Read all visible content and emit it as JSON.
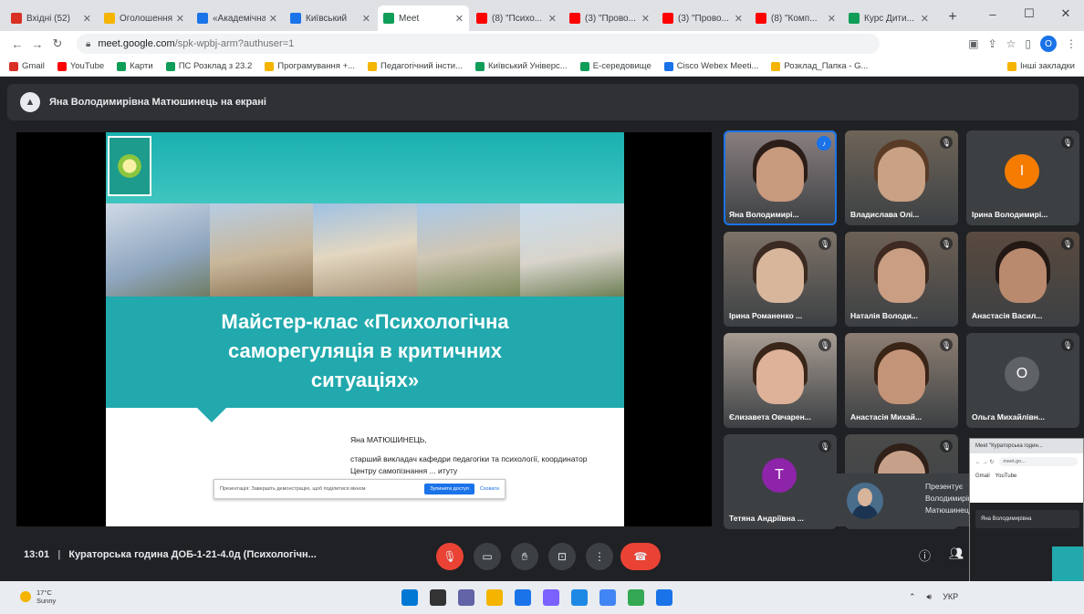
{
  "browser": {
    "tabs": [
      {
        "label": "Вхідні (52)",
        "color": "#d93025"
      },
      {
        "label": "Оголошення",
        "color": "#f4b400"
      },
      {
        "label": "«Академічна",
        "color": "#1a73e8"
      },
      {
        "label": "Київський",
        "color": "#1a73e8"
      },
      {
        "label": "Meet",
        "color": "#0f9d58",
        "active": true
      },
      {
        "label": "(8) \"Психо...",
        "color": "#ff0000"
      },
      {
        "label": "(3) \"Прово...",
        "color": "#ff0000"
      },
      {
        "label": "(3) \"Прово...",
        "color": "#ff0000"
      },
      {
        "label": "(8) \"Комп...",
        "color": "#ff0000"
      },
      {
        "label": "Курс Дити...",
        "color": "#0f9d58"
      }
    ],
    "url_host": "meet.google.com",
    "url_path": "/spk-wpbj-arm?authuser=1",
    "bookmarks": [
      {
        "label": "Gmail",
        "color": "#d93025"
      },
      {
        "label": "YouTube",
        "color": "#ff0000"
      },
      {
        "label": "Карти",
        "color": "#0f9d58"
      },
      {
        "label": "ПС Розклад з 23.2",
        "color": "#0f9d58"
      },
      {
        "label": "Програмування +...",
        "color": "#f4b400"
      },
      {
        "label": "Педагогічний інсти...",
        "color": "#f4b400"
      },
      {
        "label": "Київський Універс...",
        "color": "#0f9d58"
      },
      {
        "label": "Е-середовище",
        "color": "#0f9d58"
      },
      {
        "label": "Cisco Webex Meeti...",
        "color": "#1a73e8"
      },
      {
        "label": "Розклад_Папка - G...",
        "color": "#f4b400"
      }
    ],
    "other_bookmarks": "Інші закладки",
    "profile_letter": "O"
  },
  "meet": {
    "header_text": "Яна Володимирівна Матюшинець на екрані",
    "slide": {
      "title": "Майстер-клас «Психологічна\nсаморегуляція в критичних\nситуаціях»",
      "author": "Яна МАТЮШИНЕЦЬ,",
      "desc": "старший викладач кафедри педагогіки та психології, координатор Центру самопізнання ... итуту",
      "popup_text": "Презентація: Завершіть демонстрацію, щоб поділитися вікном",
      "popup_btn": "Зупинити доступ",
      "popup_btn2": "Сховати"
    },
    "participants": [
      {
        "name": "Яна Володимирі...",
        "type": "video",
        "speaking": true,
        "skin": "#c89a7e",
        "hair": "#2b1d17",
        "bg": "#8a7f80"
      },
      {
        "name": "Владислава Олі...",
        "type": "video",
        "skin": "#c9a184",
        "hair": "#5a3b26",
        "bg": "#6e6458"
      },
      {
        "name": "Ірина Володимирі...",
        "type": "avatar",
        "letter": "І",
        "color": "#f57c00"
      },
      {
        "name": "Ірина Романенко ...",
        "type": "video",
        "skin": "#d8b69c",
        "hair": "#3b2a21",
        "bg": "#7d7268"
      },
      {
        "name": "Наталія Володи...",
        "type": "video",
        "skin": "#c99e82",
        "hair": "#3e2a20",
        "bg": "#6d6055"
      },
      {
        "name": "Анастасія Васил...",
        "type": "video",
        "skin": "#b98a6e",
        "hair": "#241814",
        "bg": "#5a4a3f"
      },
      {
        "name": "Єлизавета Овчарен...",
        "type": "video",
        "skin": "#ddb299",
        "hair": "#3a2619",
        "bg": "#a79c93"
      },
      {
        "name": "Анастасія Михай...",
        "type": "video",
        "skin": "#c49478",
        "hair": "#3a2416",
        "bg": "#8d7e73"
      },
      {
        "name": "Ольга Михайлівн...",
        "type": "avatar",
        "letter": "О",
        "color": "#5f6368"
      },
      {
        "name": "Тетяна Андріївна ...",
        "type": "avatar",
        "letter": "Т",
        "color": "#8e24aa"
      },
      {
        "name": "",
        "type": "video",
        "skin": "#c6a088",
        "hair": "#2f2018",
        "bg": "#4a4a4a"
      }
    ],
    "presenting_label": "Презентує\nВолодимирівна\nМатюшинець",
    "bottom": {
      "time": "13:01",
      "meeting_title": "Кураторська година ДОБ-1-21-4.0д (Психологічн..."
    }
  },
  "pip": {
    "tab": "Meet \"Кураторська годин...",
    "url": "meet.go...",
    "bm1": "Gmail",
    "bm2": "YouTube",
    "header": "Яна Володимирівна"
  },
  "taskbar": {
    "temp": "17°C",
    "weather": "Sunny",
    "lang": "УКР",
    "icons": [
      "#0078d4",
      "#333333",
      "#6264a7",
      "#f4b400",
      "#1a73e8",
      "#7b61ff",
      "#1e88e5",
      "#4285f4",
      "#34a853",
      "#1a73e8"
    ]
  },
  "colors": {
    "meet_bg": "#202124",
    "slide_teal": "#21a9ad",
    "end_call": "#ea4335",
    "speaking": "#1a73e8"
  }
}
